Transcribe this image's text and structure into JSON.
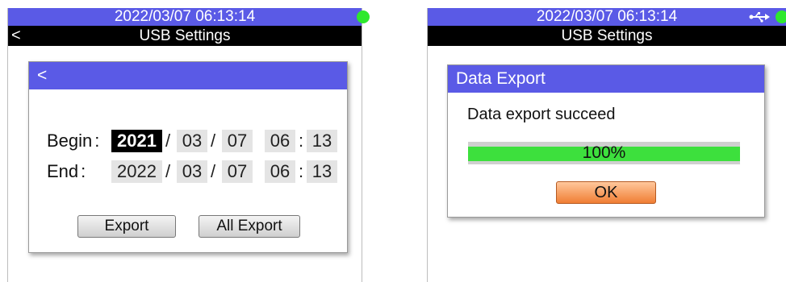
{
  "colors": {
    "header_blue": "#5a5ae6",
    "status_green": "#2ee82e",
    "progress_green": "#3de03d",
    "ok_orange": "#f07e34"
  },
  "left": {
    "datetime": "2022/03/07 06:13:14",
    "status_icon": "green-dot-icon",
    "back_icon": "<",
    "title": "USB Settings",
    "dialog": {
      "back_icon": "<",
      "begin_label": "Begin",
      "end_label": "End",
      "colon": ":",
      "date_sep": "/",
      "time_sep": ":",
      "begin": {
        "year": "2021",
        "month": "03",
        "day": "07",
        "hour": "06",
        "minute": "13"
      },
      "end": {
        "year": "2022",
        "month": "03",
        "day": "07",
        "hour": "06",
        "minute": "13"
      },
      "export_button": "Export",
      "all_export_button": "All Export"
    }
  },
  "right": {
    "datetime": "2022/03/07 06:13:14",
    "usb_icon": "usb-icon",
    "status_icon": "green-dot-icon",
    "title": "USB Settings",
    "dialog": {
      "title": "Data Export",
      "message": "Data export succeed",
      "progress_percent": 100,
      "progress_label": "100%",
      "ok_button": "OK"
    }
  }
}
